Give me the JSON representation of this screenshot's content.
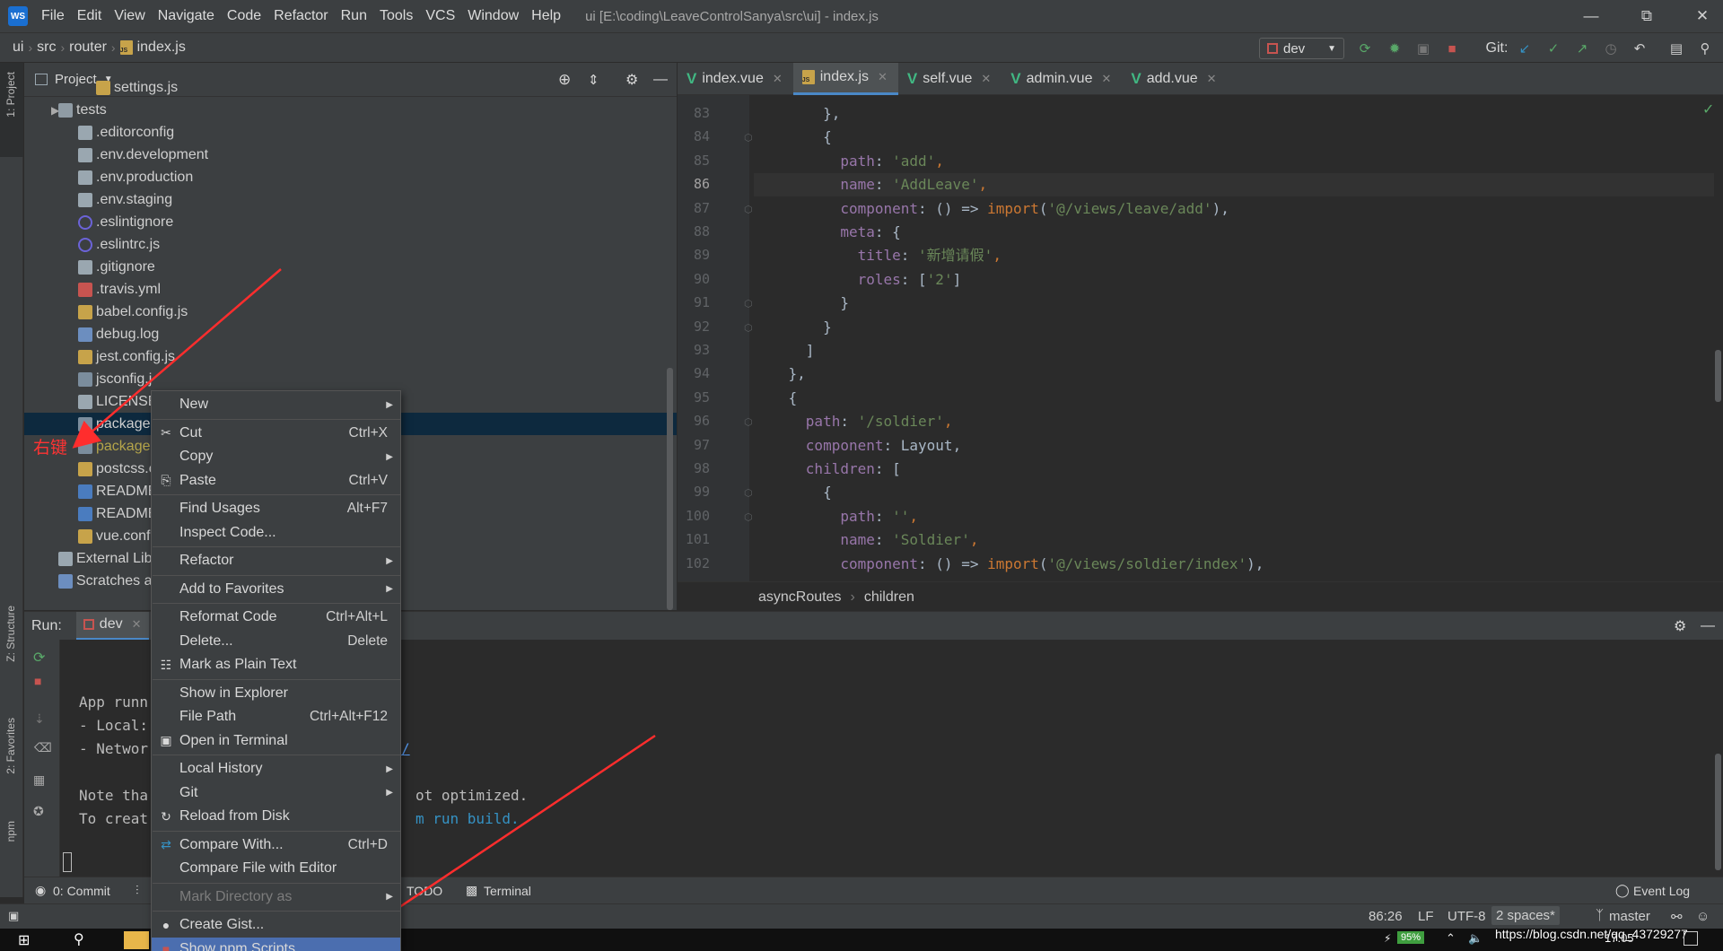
{
  "app": {
    "logo_text": "WS",
    "menu": [
      "File",
      "Edit",
      "View",
      "Navigate",
      "Code",
      "Refactor",
      "Run",
      "Tools",
      "VCS",
      "Window",
      "Help"
    ],
    "window_title": "ui [E:\\coding\\LeaveControlSanya\\src\\ui] - index.js"
  },
  "navbar": {
    "crumbs": [
      "ui",
      "src",
      "router",
      "index.js"
    ],
    "run_config": "dev",
    "git_label": "Git:"
  },
  "left_strip": {
    "project": "1: Project",
    "structure": "Z: Structure",
    "favorites": "2: Favorites",
    "npm": "npm"
  },
  "project": {
    "title": "Project",
    "tree": [
      {
        "name": "settings.js",
        "icon": "js-file-icon"
      },
      {
        "name": "tests",
        "icon": "folder-icon"
      },
      {
        "name": ".editorconfig",
        "icon": "gear-icon"
      },
      {
        "name": ".env.development",
        "icon": "text-file-icon"
      },
      {
        "name": ".env.production",
        "icon": "text-file-icon"
      },
      {
        "name": ".env.staging",
        "icon": "text-file-icon"
      },
      {
        "name": ".eslintignore",
        "icon": "eslint-icon"
      },
      {
        "name": ".eslintrc.js",
        "icon": "eslint-icon"
      },
      {
        "name": ".gitignore",
        "icon": "git-file-icon"
      },
      {
        "name": ".travis.yml",
        "icon": "yml-file-icon"
      },
      {
        "name": "babel.config.js",
        "icon": "js-file-icon"
      },
      {
        "name": "debug.log",
        "icon": "log-file-icon"
      },
      {
        "name": "jest.config.js",
        "icon": "js-file-icon"
      },
      {
        "name": "jsconfig.j",
        "icon": "json-file-icon"
      },
      {
        "name": "LICENSE",
        "icon": "text-file-icon"
      },
      {
        "name": "package.",
        "icon": "json-file-icon"
      },
      {
        "name": "package-",
        "icon": "json-file-icon"
      },
      {
        "name": "postcss.c",
        "icon": "js-file-icon"
      },
      {
        "name": "README.",
        "icon": "md-file-icon"
      },
      {
        "name": "README",
        "icon": "md-file-icon"
      },
      {
        "name": "vue.confi",
        "icon": "js-file-icon"
      },
      {
        "name": "External Libr",
        "icon": "library-icon"
      },
      {
        "name": "Scratches ar",
        "icon": "scratch-icon"
      }
    ]
  },
  "editor": {
    "tabs": [
      {
        "label": "index.vue",
        "type": "vue"
      },
      {
        "label": "index.js",
        "type": "js",
        "active": true
      },
      {
        "label": "self.vue",
        "type": "vue"
      },
      {
        "label": "admin.vue",
        "type": "vue"
      },
      {
        "label": "add.vue",
        "type": "vue"
      }
    ],
    "line_numbers": [
      "83",
      "84",
      "85",
      "86",
      "87",
      "88",
      "89",
      "90",
      "91",
      "92",
      "93",
      "94",
      "95",
      "96",
      "97",
      "98",
      "99",
      "100",
      "101",
      "102"
    ],
    "code_lines": [
      [
        {
          "t": "        },",
          "c": "p"
        }
      ],
      [
        {
          "t": "        {",
          "c": "p"
        }
      ],
      [
        {
          "t": "          path",
          "c": "k"
        },
        {
          "t": ": ",
          "c": "p"
        },
        {
          "t": "'add'",
          "c": "s"
        },
        {
          "t": ",",
          "c": "kw"
        }
      ],
      [
        {
          "t": "          name",
          "c": "k"
        },
        {
          "t": ": ",
          "c": "p"
        },
        {
          "t": "'AddLeave'",
          "c": "s"
        },
        {
          "t": ",",
          "c": "kw"
        }
      ],
      [
        {
          "t": "          component",
          "c": "k"
        },
        {
          "t": ": () => ",
          "c": "p"
        },
        {
          "t": "import",
          "c": "kw"
        },
        {
          "t": "(",
          "c": "p"
        },
        {
          "t": "'@/views/leave/add'",
          "c": "s"
        },
        {
          "t": "),",
          "c": "p"
        }
      ],
      [
        {
          "t": "          meta",
          "c": "k"
        },
        {
          "t": ": {",
          "c": "p"
        }
      ],
      [
        {
          "t": "            title",
          "c": "k"
        },
        {
          "t": ": ",
          "c": "p"
        },
        {
          "t": "'新增请假'",
          "c": "s"
        },
        {
          "t": ",",
          "c": "kw"
        }
      ],
      [
        {
          "t": "            roles",
          "c": "k"
        },
        {
          "t": ": [",
          "c": "p"
        },
        {
          "t": "'2'",
          "c": "s"
        },
        {
          "t": "]",
          "c": "p"
        }
      ],
      [
        {
          "t": "          }",
          "c": "p"
        }
      ],
      [
        {
          "t": "        }",
          "c": "p"
        }
      ],
      [
        {
          "t": "      ]",
          "c": "p"
        }
      ],
      [
        {
          "t": "    },",
          "c": "p"
        }
      ],
      [
        {
          "t": "    {",
          "c": "p"
        }
      ],
      [
        {
          "t": "      path",
          "c": "k"
        },
        {
          "t": ": ",
          "c": "p"
        },
        {
          "t": "'/soldier'",
          "c": "s"
        },
        {
          "t": ",",
          "c": "kw"
        }
      ],
      [
        {
          "t": "      component",
          "c": "k"
        },
        {
          "t": ": Layout,",
          "c": "p"
        }
      ],
      [
        {
          "t": "      children",
          "c": "k"
        },
        {
          "t": ": [",
          "c": "p"
        }
      ],
      [
        {
          "t": "        {",
          "c": "p"
        }
      ],
      [
        {
          "t": "          path",
          "c": "k"
        },
        {
          "t": ": ",
          "c": "p"
        },
        {
          "t": "''",
          "c": "s"
        },
        {
          "t": ",",
          "c": "kw"
        }
      ],
      [
        {
          "t": "          name",
          "c": "k"
        },
        {
          "t": ": ",
          "c": "p"
        },
        {
          "t": "'Soldier'",
          "c": "s"
        },
        {
          "t": ",",
          "c": "kw"
        }
      ],
      [
        {
          "t": "          component",
          "c": "k"
        },
        {
          "t": ": () => ",
          "c": "p"
        },
        {
          "t": "import",
          "c": "kw"
        },
        {
          "t": "(",
          "c": "p"
        },
        {
          "t": "'@/views/soldier/index'",
          "c": "s"
        },
        {
          "t": "),",
          "c": "p"
        }
      ]
    ],
    "current_line": "86",
    "breadcrumbs": [
      "asyncRoutes",
      "children"
    ]
  },
  "run": {
    "label": "Run:",
    "tab": "dev",
    "console": [
      "App runn",
      "- Local:",
      "- Networ",
      "Note tha",
      "To creat"
    ],
    "console_tail": [
      "ot optimized.",
      "m run build."
    ],
    "url_fragment": "/"
  },
  "bottom_tools": {
    "commit": "0: Commit",
    "todo": "TODO",
    "terminal": "Terminal",
    "event_log": "Event Log"
  },
  "status": {
    "position": "86:26",
    "line_sep": "LF",
    "encoding": "UTF-8",
    "indent": "2 spaces*",
    "branch": "master"
  },
  "taskbar": {
    "battery": "95%",
    "time": "17:05",
    "watermark": "https://blog.csdn.net/qq_43729277"
  },
  "annotation": {
    "label": "右键"
  },
  "context_menu": {
    "items": [
      {
        "label": "New",
        "submenu": true
      },
      {
        "sep": true
      },
      {
        "label": "Cut",
        "shortcut": "Ctrl+X",
        "icon": "scissors-icon"
      },
      {
        "label": "Copy",
        "submenu": true
      },
      {
        "label": "Paste",
        "shortcut": "Ctrl+V",
        "icon": "clipboard-icon"
      },
      {
        "sep": true
      },
      {
        "label": "Find Usages",
        "shortcut": "Alt+F7"
      },
      {
        "label": "Inspect Code..."
      },
      {
        "sep": true
      },
      {
        "label": "Refactor",
        "submenu": true
      },
      {
        "sep": true
      },
      {
        "label": "Add to Favorites",
        "submenu": true
      },
      {
        "sep": true
      },
      {
        "label": "Reformat Code",
        "shortcut": "Ctrl+Alt+L"
      },
      {
        "label": "Delete...",
        "shortcut": "Delete"
      },
      {
        "label": "Mark as Plain Text",
        "icon": "plain-text-icon"
      },
      {
        "sep": true
      },
      {
        "label": "Show in Explorer"
      },
      {
        "label": "File Path",
        "shortcut": "Ctrl+Alt+F12"
      },
      {
        "label": "Open in Terminal",
        "icon": "terminal-icon"
      },
      {
        "sep": true
      },
      {
        "label": "Local History",
        "submenu": true
      },
      {
        "label": "Git",
        "submenu": true
      },
      {
        "label": "Reload from Disk",
        "icon": "reload-icon"
      },
      {
        "sep": true
      },
      {
        "label": "Compare With...",
        "shortcut": "Ctrl+D",
        "icon": "compare-icon"
      },
      {
        "label": "Compare File with Editor"
      },
      {
        "sep": true
      },
      {
        "label": "Mark Directory as",
        "submenu": true,
        "disabled": true
      },
      {
        "sep": true
      },
      {
        "label": "Create Gist...",
        "icon": "github-icon"
      },
      {
        "label": "Show npm Scripts",
        "icon": "npm-icon",
        "hover": true
      }
    ]
  },
  "colors": {
    "accent": "#4b6eaf",
    "selection": "#0d293e",
    "annotation": "#ff3333"
  }
}
